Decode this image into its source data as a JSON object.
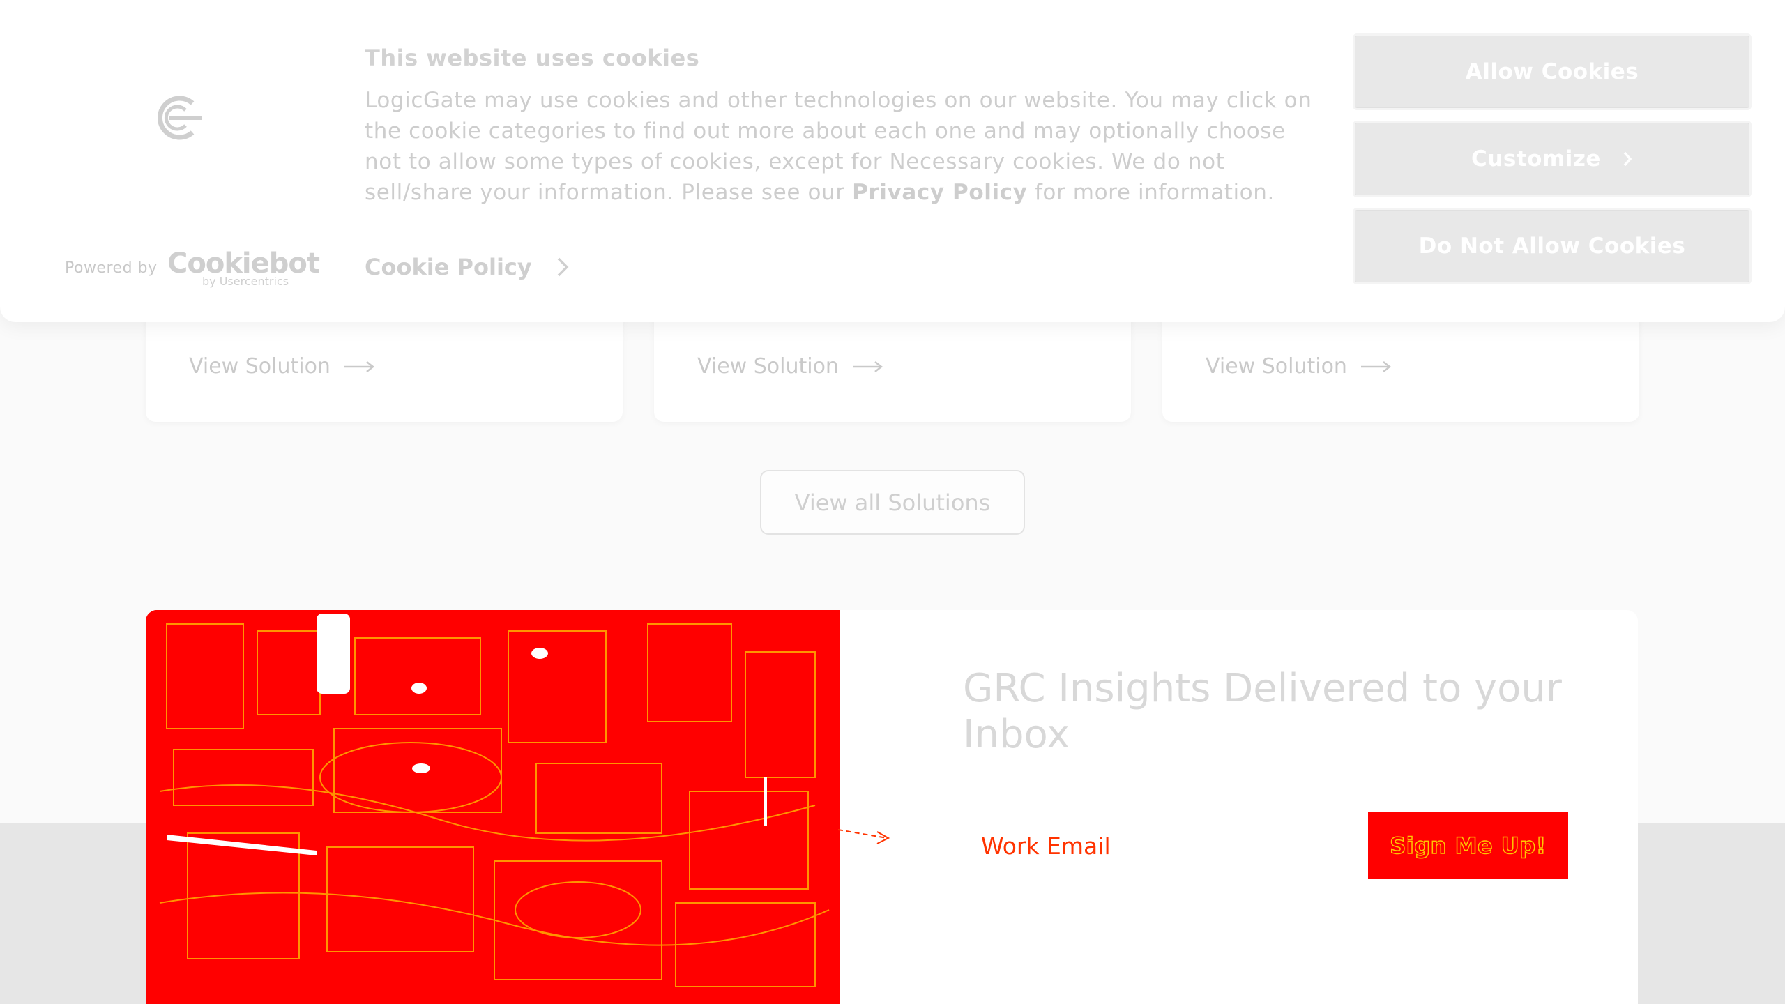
{
  "solutions": {
    "cards": [
      {
        "link_label": "View Solution"
      },
      {
        "link_label": "View Solution"
      },
      {
        "link_label": "View Solution"
      }
    ],
    "view_all_label": "View all Solutions"
  },
  "newsletter": {
    "title": "GRC Insights Delivered to your Inbox",
    "email_placeholder": "Work Email",
    "submit_label": "Sign Me Up!"
  },
  "cookie_banner": {
    "powered_by": "Powered by",
    "provider_logo_text": "Cookiebot",
    "provider_logo_subtext": "by Usercentrics",
    "title": "This website uses cookies",
    "body_before_link": "LogicGate may use cookies and other technologies on our website. You may click on the cookie categories to find out more about each one and may optionally choose not to allow some types of cookies, except for Necessary cookies.  We do not sell/share your information. Please see our ",
    "privacy_link": "Privacy Policy",
    "body_after_link": " for more information.",
    "policy_link": "Cookie Policy",
    "buttons": {
      "allow": "Allow Cookies",
      "customize": "Customize",
      "deny": "Do Not Allow Cookies"
    }
  },
  "colors": {
    "accent_red": "#ff0000",
    "outline_yellow": "#ffc600",
    "muted_text": "#cdcdcd"
  },
  "icons": [
    "logicgate-logo-icon",
    "arrow-right-icon",
    "chevron-right-icon",
    "dashed-arrow-icon"
  ]
}
